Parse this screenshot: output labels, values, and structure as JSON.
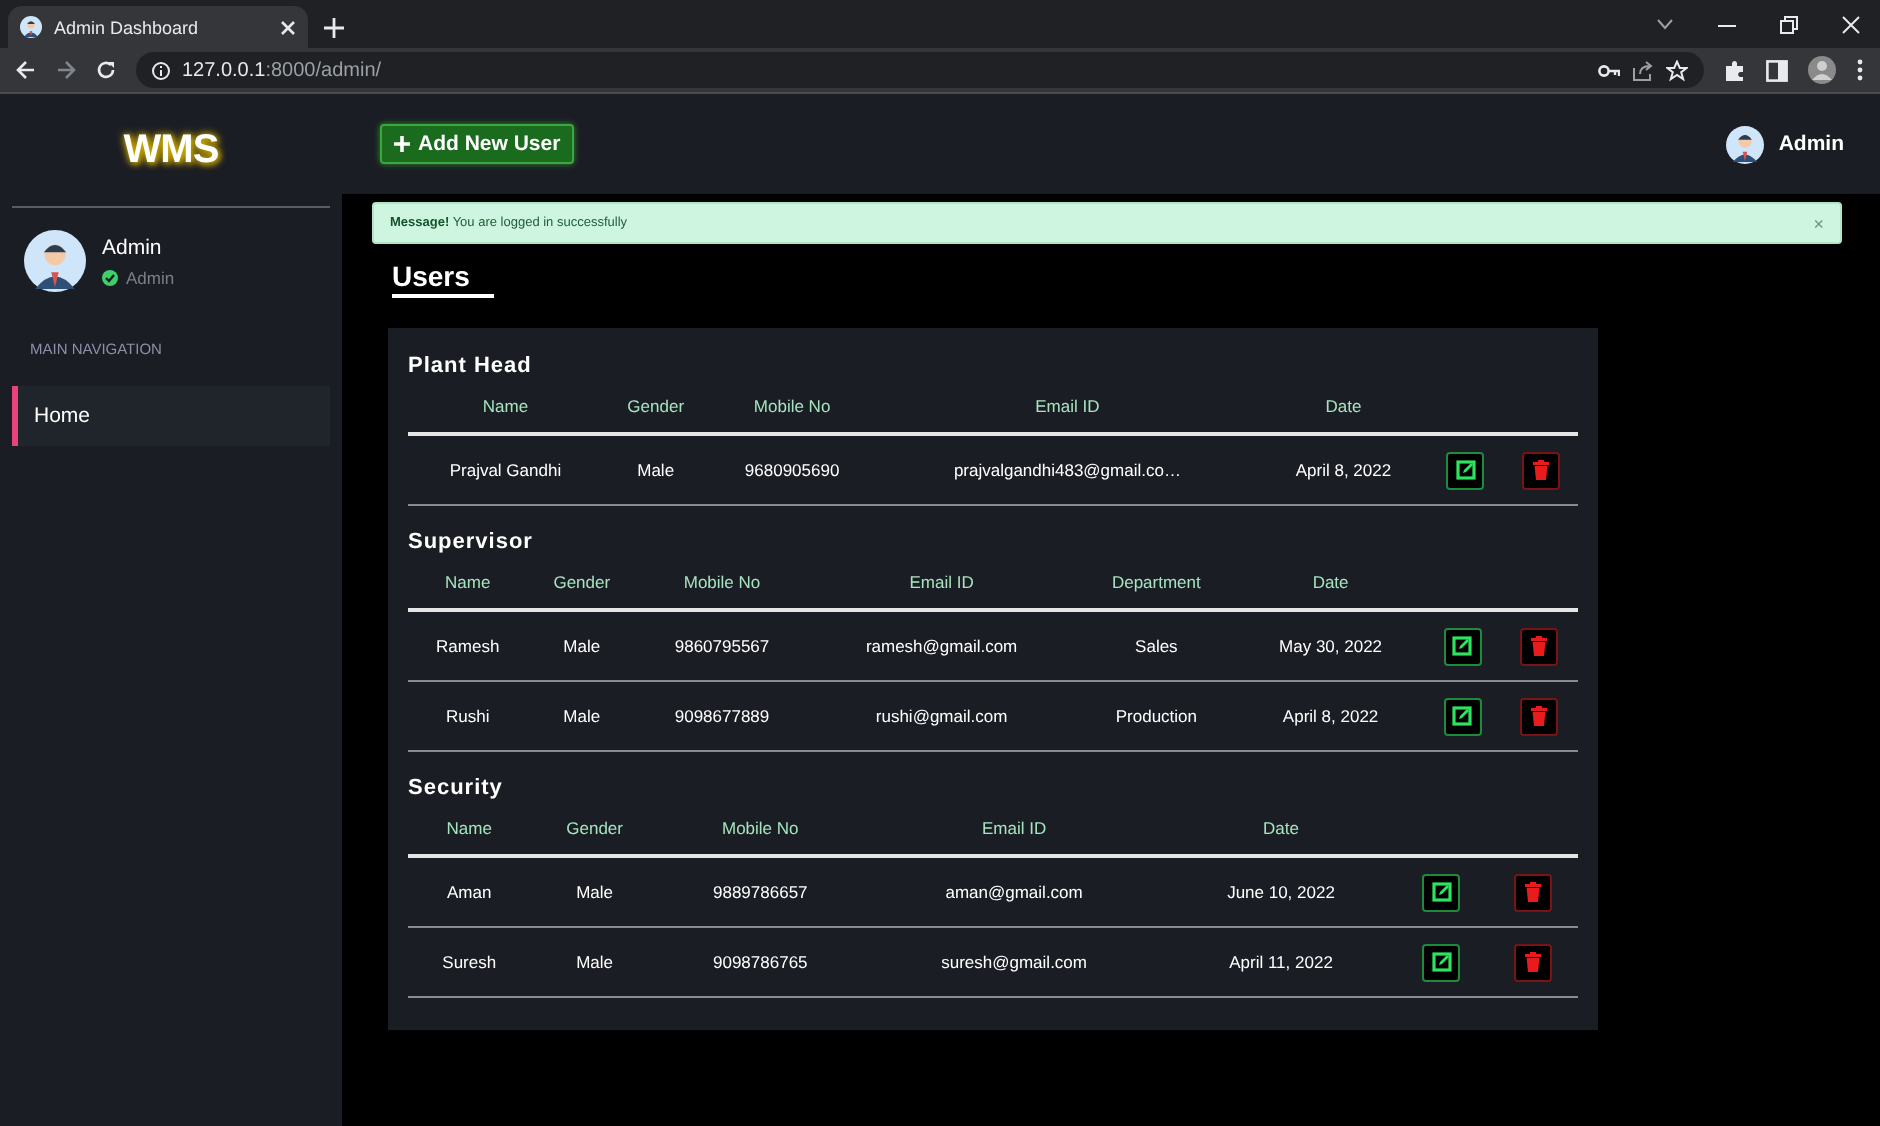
{
  "browser": {
    "tab_title": "Admin Dashboard",
    "url_host": "127.0.0.1",
    "url_path": ":8000/admin/"
  },
  "sidebar": {
    "logo": "WMS",
    "user_name": "Admin",
    "user_role": "Admin",
    "section_label": "MAIN NAVIGATION",
    "items": [
      {
        "label": "Home",
        "selected": true
      }
    ]
  },
  "topbar": {
    "add_button": "Add New User",
    "user_name": "Admin"
  },
  "alert": {
    "message": "**Message!** You are logged in successfully",
    "close": "×"
  },
  "page_title": "Users",
  "groups": [
    {
      "title": "Plant Head",
      "columns": [
        "Name",
        "Gender",
        "Mobile No",
        "Email ID",
        "Date"
      ],
      "rows": [
        {
          "cells": [
            "Prajval Gandhi",
            "Male",
            "9680905690",
            "prajvalgandhi483@gmail.co…",
            "April 8, 2022"
          ]
        }
      ]
    },
    {
      "title": "Supervisor",
      "columns": [
        "Name",
        "Gender",
        "Mobile No",
        "Email ID",
        "Department",
        "Date"
      ],
      "rows": [
        {
          "cells": [
            "Ramesh",
            "Male",
            "9860795567",
            "ramesh@gmail.com",
            "Sales",
            "May 30, 2022"
          ]
        },
        {
          "cells": [
            "Rushi",
            "Male",
            "9098677889",
            "rushi@gmail.com",
            "Production",
            "April 8, 2022"
          ]
        }
      ]
    },
    {
      "title": "Security",
      "columns": [
        "Name",
        "Gender",
        "Mobile No",
        "Email ID",
        "Date"
      ],
      "rows": [
        {
          "cells": [
            "Aman",
            "Male",
            "9889786657",
            "aman@gmail.com",
            "June 10, 2022"
          ]
        },
        {
          "cells": [
            "Suresh",
            "Male",
            "9098786765",
            "suresh@gmail.com",
            "April 11, 2022"
          ]
        }
      ]
    }
  ]
}
